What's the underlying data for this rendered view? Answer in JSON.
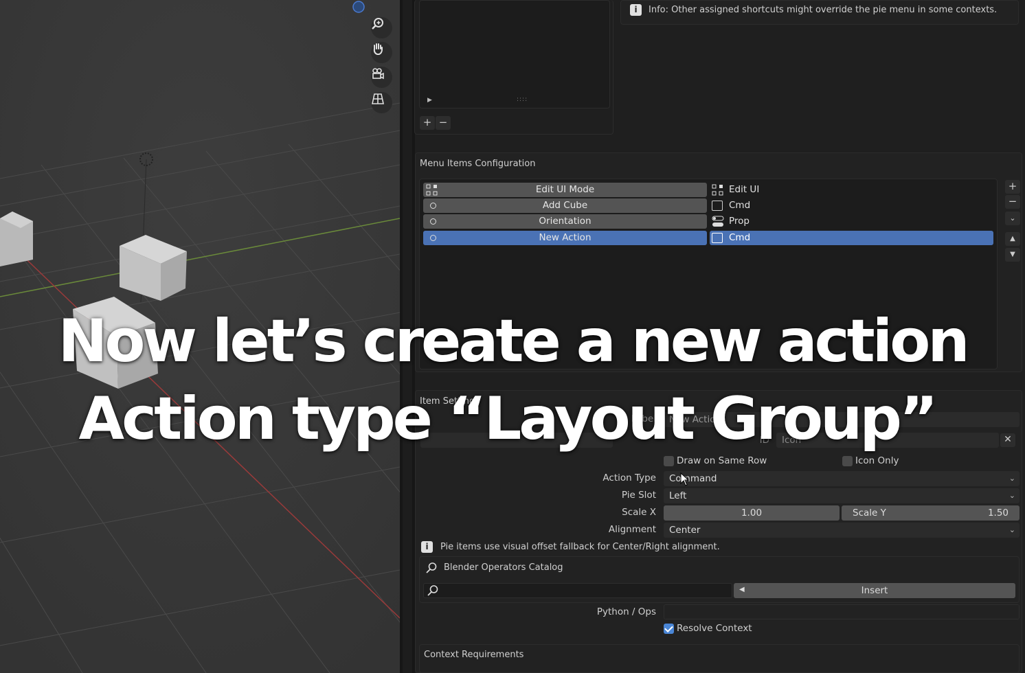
{
  "info_top": "Info: Other assigned shortcuts might override the pie menu in some contexts.",
  "menu_items_config": {
    "title": "Menu Items Configuration",
    "items": [
      {
        "name": "Edit UI Mode",
        "type": "Edit UI",
        "selected": false
      },
      {
        "name": "Add Cube",
        "type": "Cmd",
        "selected": false
      },
      {
        "name": "Orientation",
        "type": "Prop",
        "selected": false
      },
      {
        "name": "New Action",
        "type": "Cmd",
        "selected": true
      }
    ]
  },
  "item_settings": {
    "title": "Item Settings",
    "label_field_label": "Label",
    "label_value": "New Action",
    "id_label": "ID",
    "id_value": "Icon",
    "draw_same_row": "Draw on Same Row",
    "icon_only": "Icon Only",
    "action_type_label": "Action Type",
    "action_type_value": "Command",
    "pie_slot_label": "Pie Slot",
    "pie_slot_value": "Left",
    "scale_x_label": "Scale X",
    "scale_x_value": "1.00",
    "scale_y_label": "Scale Y",
    "scale_y_value": "1.50",
    "alignment_label": "Alignment",
    "alignment_value": "Center",
    "info_pie": "Pie items use visual offset fallback for Center/Right alignment.",
    "catalog_title": "Blender Operators Catalog",
    "insert_label": "Insert",
    "python_ops_label": "Python / Ops",
    "resolve_context": "Resolve Context",
    "context_requirements": "Context Requirements"
  },
  "captions": {
    "line1": "Now let’s create a new action",
    "line2": "Action type “Layout Group”"
  },
  "colors": {
    "selection": "#4a72b5",
    "checkbox_on": "#4a86d6"
  }
}
